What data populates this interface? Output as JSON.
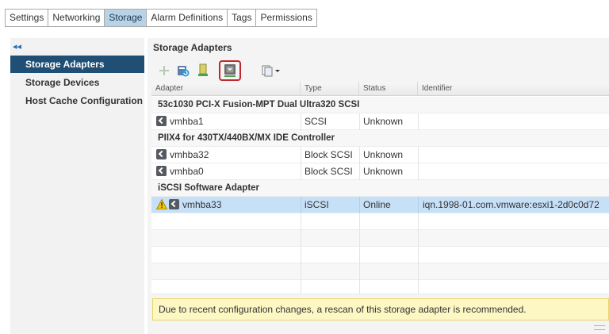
{
  "tabs": [
    {
      "label": "Settings"
    },
    {
      "label": "Networking"
    },
    {
      "label": "Storage"
    },
    {
      "label": "Alarm Definitions"
    },
    {
      "label": "Tags"
    },
    {
      "label": "Permissions"
    }
  ],
  "active_tab": "Storage",
  "leftnav": {
    "collapse_glyph": "◂◂",
    "items": [
      {
        "label": "Storage Adapters"
      },
      {
        "label": "Storage Devices"
      },
      {
        "label": "Host Cache Configuration"
      }
    ],
    "selected": "Storage Adapters"
  },
  "panel": {
    "title": "Storage Adapters",
    "toolbar_icons": [
      "add-icon",
      "rescan-icon",
      "rescan-vmfs-icon",
      "rescan-adapter-icon",
      "actions-menu-icon"
    ]
  },
  "table": {
    "columns": [
      "Adapter",
      "Type",
      "Status",
      "Identifier"
    ],
    "groups": [
      {
        "name": "53c1030 PCI-X Fusion-MPT Dual Ultra320 SCSI",
        "rows": [
          {
            "adapter": "vmhba1",
            "type": "SCSI",
            "status": "Unknown",
            "identifier": ""
          }
        ]
      },
      {
        "name": "PIIX4 for 430TX/440BX/MX IDE Controller",
        "rows": [
          {
            "adapter": "vmhba32",
            "type": "Block SCSI",
            "status": "Unknown",
            "identifier": ""
          },
          {
            "adapter": "vmhba0",
            "type": "Block SCSI",
            "status": "Unknown",
            "identifier": ""
          }
        ]
      },
      {
        "name": "iSCSI Software Adapter",
        "rows": [
          {
            "adapter": "vmhba33",
            "type": "iSCSI",
            "status": "Online",
            "identifier": "iqn.1998-01.com.vmware:esxi1-2d0c0d72",
            "warning": true
          }
        ]
      }
    ]
  },
  "notice": "Due to recent configuration changes, a rescan of this storage adapter is recommended.",
  "colors": {
    "accent": "#1f4f75",
    "tab_active": "#b8d2e6",
    "row_selected": "#c6e0f7",
    "notice_bg": "#fdf7c3",
    "highlight_border": "#c0282d"
  }
}
